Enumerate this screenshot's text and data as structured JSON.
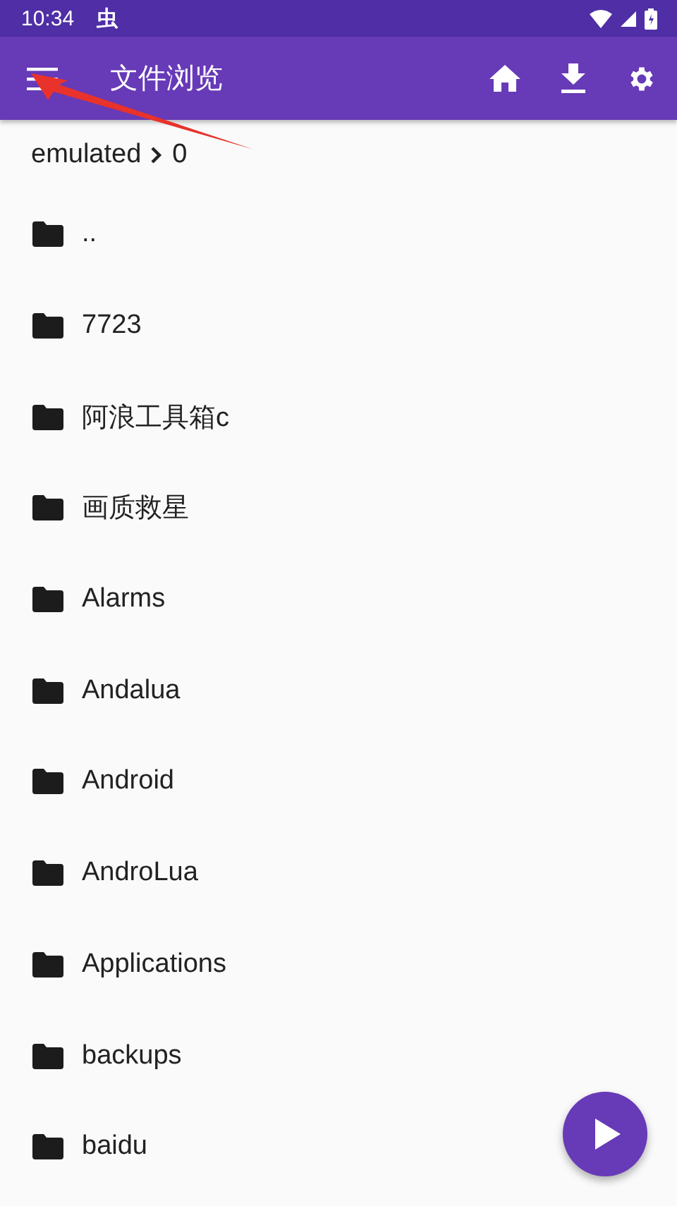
{
  "status_bar": {
    "time": "10:34",
    "notification": "虫"
  },
  "app_bar": {
    "title": "文件浏览"
  },
  "breadcrumb": [
    "emulated",
    "0"
  ],
  "files": [
    {
      "name": ".."
    },
    {
      "name": "7723"
    },
    {
      "name": "阿浪工具箱c"
    },
    {
      "name": "画质救星"
    },
    {
      "name": "Alarms"
    },
    {
      "name": "Andalua"
    },
    {
      "name": "Android"
    },
    {
      "name": "AndroLua"
    },
    {
      "name": "Applications"
    },
    {
      "name": "backups"
    },
    {
      "name": "baidu"
    }
  ]
}
